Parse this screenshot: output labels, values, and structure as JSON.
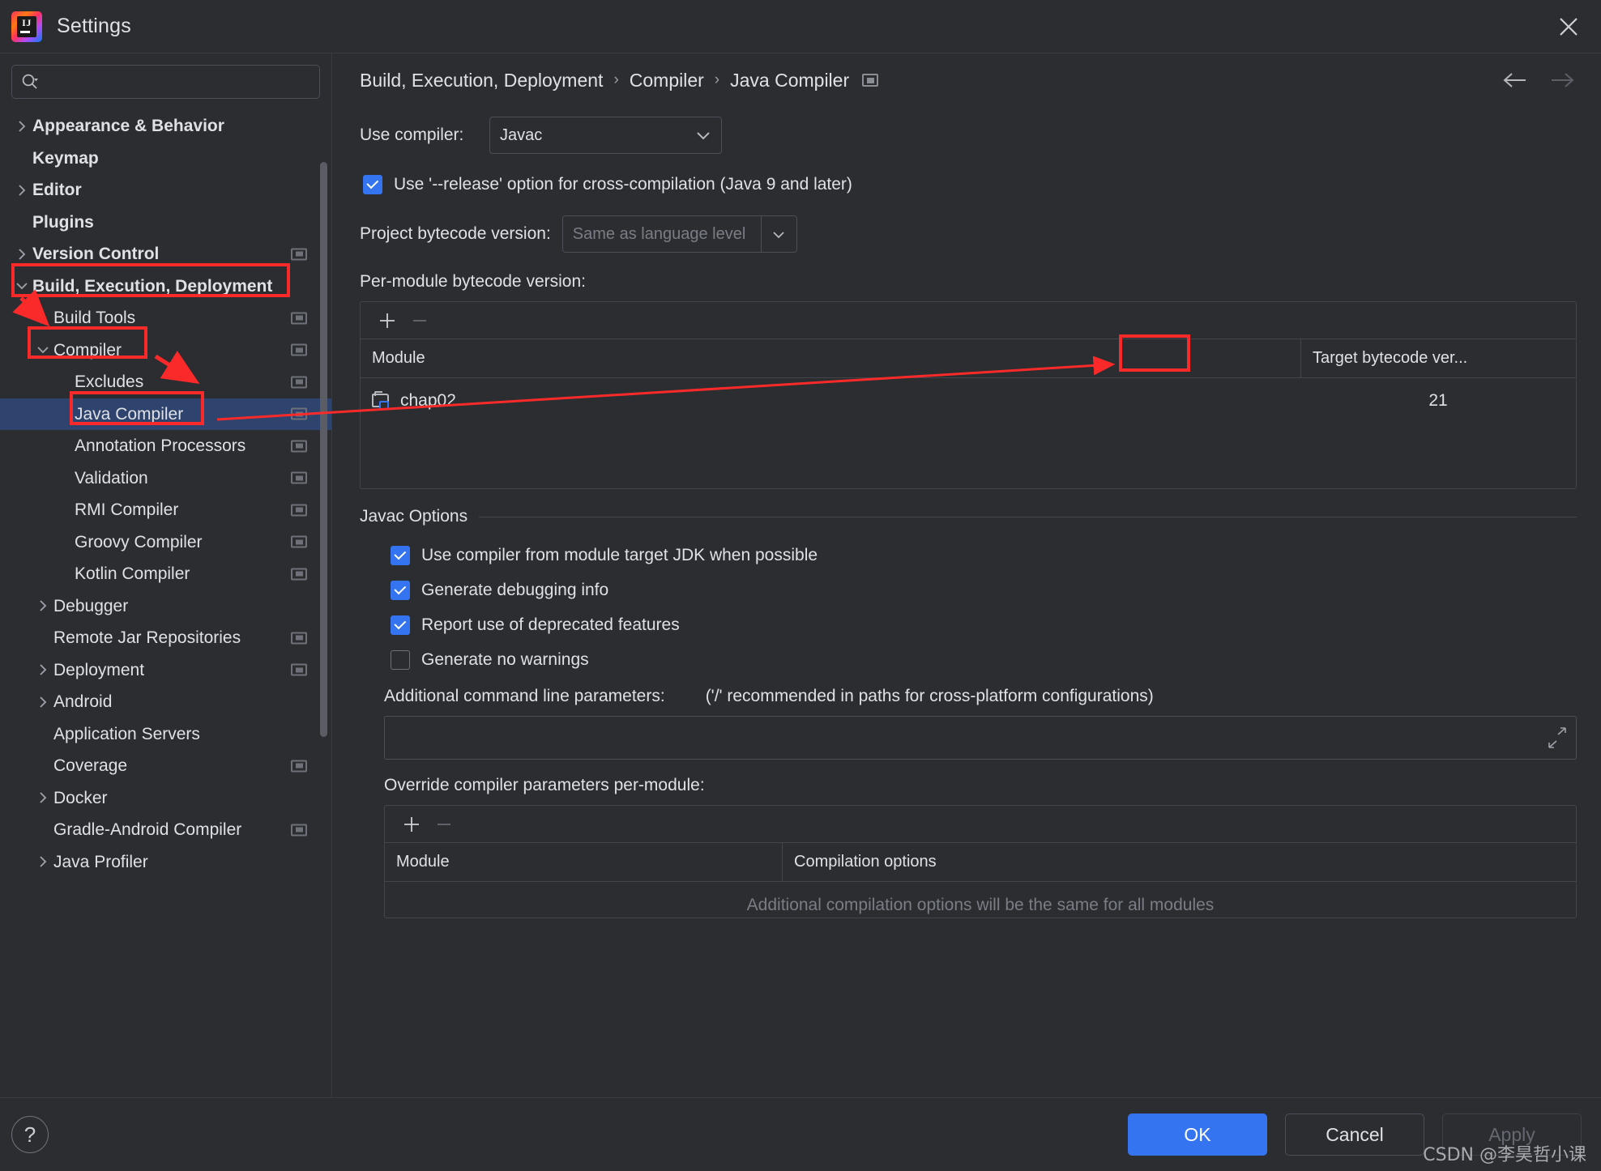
{
  "window": {
    "title": "Settings",
    "logo_text": "IJ",
    "close_icon": "close-icon"
  },
  "search": {
    "value": "",
    "placeholder": "",
    "icon": "search-icon"
  },
  "sidebar": {
    "items": [
      {
        "label": "Appearance & Behavior",
        "arrow": "collapsed",
        "indent": 0,
        "bold": true,
        "scope": false,
        "selected": false
      },
      {
        "label": "Keymap",
        "arrow": "none",
        "indent": 0,
        "bold": true,
        "scope": false,
        "selected": false
      },
      {
        "label": "Editor",
        "arrow": "collapsed",
        "indent": 0,
        "bold": true,
        "scope": false,
        "selected": false
      },
      {
        "label": "Plugins",
        "arrow": "none",
        "indent": 0,
        "bold": true,
        "scope": false,
        "selected": false
      },
      {
        "label": "Version Control",
        "arrow": "collapsed",
        "indent": 0,
        "bold": true,
        "scope": true,
        "selected": false
      },
      {
        "label": "Build, Execution, Deployment",
        "arrow": "expanded",
        "indent": 0,
        "bold": true,
        "scope": false,
        "selected": false
      },
      {
        "label": "Build Tools",
        "arrow": "collapsed",
        "indent": 1,
        "bold": false,
        "scope": true,
        "selected": false
      },
      {
        "label": "Compiler",
        "arrow": "expanded",
        "indent": 1,
        "bold": false,
        "scope": true,
        "selected": false
      },
      {
        "label": "Excludes",
        "arrow": "none",
        "indent": 2,
        "bold": false,
        "scope": true,
        "selected": false
      },
      {
        "label": "Java Compiler",
        "arrow": "none",
        "indent": 2,
        "bold": false,
        "scope": true,
        "selected": true
      },
      {
        "label": "Annotation Processors",
        "arrow": "none",
        "indent": 2,
        "bold": false,
        "scope": true,
        "selected": false
      },
      {
        "label": "Validation",
        "arrow": "none",
        "indent": 2,
        "bold": false,
        "scope": true,
        "selected": false
      },
      {
        "label": "RMI Compiler",
        "arrow": "none",
        "indent": 2,
        "bold": false,
        "scope": true,
        "selected": false
      },
      {
        "label": "Groovy Compiler",
        "arrow": "none",
        "indent": 2,
        "bold": false,
        "scope": true,
        "selected": false
      },
      {
        "label": "Kotlin Compiler",
        "arrow": "none",
        "indent": 2,
        "bold": false,
        "scope": true,
        "selected": false
      },
      {
        "label": "Debugger",
        "arrow": "collapsed",
        "indent": 1,
        "bold": false,
        "scope": false,
        "selected": false
      },
      {
        "label": "Remote Jar Repositories",
        "arrow": "none",
        "indent": 1,
        "bold": false,
        "scope": true,
        "selected": false
      },
      {
        "label": "Deployment",
        "arrow": "collapsed",
        "indent": 1,
        "bold": false,
        "scope": true,
        "selected": false
      },
      {
        "label": "Android",
        "arrow": "collapsed",
        "indent": 1,
        "bold": false,
        "scope": false,
        "selected": false
      },
      {
        "label": "Application Servers",
        "arrow": "none",
        "indent": 1,
        "bold": false,
        "scope": false,
        "selected": false
      },
      {
        "label": "Coverage",
        "arrow": "none",
        "indent": 1,
        "bold": false,
        "scope": true,
        "selected": false
      },
      {
        "label": "Docker",
        "arrow": "collapsed",
        "indent": 1,
        "bold": false,
        "scope": false,
        "selected": false
      },
      {
        "label": "Gradle-Android Compiler",
        "arrow": "none",
        "indent": 1,
        "bold": false,
        "scope": true,
        "selected": false
      },
      {
        "label": "Java Profiler",
        "arrow": "collapsed",
        "indent": 1,
        "bold": false,
        "scope": false,
        "selected": false
      }
    ]
  },
  "breadcrumb": {
    "parts": [
      "Build, Execution, Deployment",
      "Compiler",
      "Java Compiler"
    ],
    "separator": "›",
    "scope_icon": "project-scope-icon",
    "back_icon": "arrow-left-icon",
    "forward_icon": "arrow-right-icon"
  },
  "main": {
    "use_compiler_label": "Use compiler:",
    "use_compiler_value": "Javac",
    "release_option_label": "Use '--release' option for cross-compilation (Java 9 and later)",
    "release_option_checked": true,
    "project_bytecode_label": "Project bytecode version:",
    "project_bytecode_value": "Same as language level",
    "per_module_label": "Per-module bytecode version:",
    "module_table": {
      "add_icon": "plus-icon",
      "remove_icon": "minus-icon",
      "columns": [
        "Module",
        "Target bytecode ver..."
      ],
      "rows": [
        {
          "module": "chap02",
          "target": "21"
        }
      ]
    },
    "javac_options_title": "Javac Options",
    "javac_options": [
      {
        "label": "Use compiler from module target JDK when possible",
        "checked": true
      },
      {
        "label": "Generate debugging info",
        "checked": true
      },
      {
        "label": "Report use of deprecated features",
        "checked": true
      },
      {
        "label": "Generate no warnings",
        "checked": false
      }
    ],
    "additional_params_label": "Additional command line parameters:",
    "additional_params_hint": "('/' recommended in paths for cross-platform configurations)",
    "additional_params_value": "",
    "expand_icon": "expand-icon",
    "override_label": "Override compiler parameters per-module:",
    "override_table": {
      "add_icon": "plus-icon",
      "remove_icon": "minus-icon",
      "columns": [
        "Module",
        "Compilation options"
      ],
      "empty_message": "Additional compilation options will be the same for all modules"
    }
  },
  "footer": {
    "help_icon": "help-icon",
    "help_label": "?",
    "ok_label": "OK",
    "cancel_label": "Cancel",
    "apply_label": "Apply",
    "apply_disabled": true,
    "watermark": "CSDN @李昊哲小课"
  },
  "colors": {
    "accent": "#3574f0",
    "annotation": "#fb2a2a",
    "selection": "#2e436e",
    "background": "#2b2d30"
  }
}
